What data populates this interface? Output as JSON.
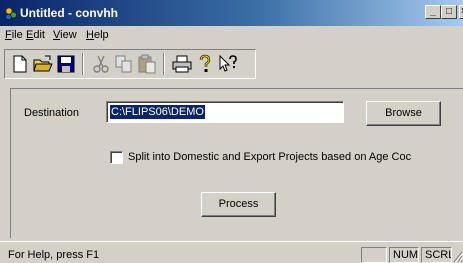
{
  "window": {
    "title": "Untitled - convhh",
    "minimize_glyph": "_",
    "maximize_glyph": "□",
    "close_glyph": "×"
  },
  "menu": {
    "items": [
      {
        "first": "F",
        "rest": "ile"
      },
      {
        "first": "E",
        "rest": "dit"
      },
      {
        "first": "V",
        "rest": "iew"
      },
      {
        "first": "H",
        "rest": "elp"
      }
    ]
  },
  "toolbar": {
    "buttons": [
      "new-file-icon",
      "open-folder-icon",
      "save-icon",
      "cut-icon",
      "copy-icon",
      "paste-icon",
      "print-icon",
      "about-icon",
      "context-help-icon"
    ]
  },
  "form": {
    "destination_label": "Destination",
    "destination_value": "C:\\FLIPS06\\DEMO",
    "browse_label": "Browse",
    "split_label": "Split into Domestic and Export Projects based on Age Coc",
    "split_checked": false,
    "process_label": "Process"
  },
  "statusbar": {
    "message": "For Help, press F1",
    "cap": "",
    "num": "NUM",
    "scrl": "SCRL"
  },
  "colors": {
    "face": "#d4d0c8",
    "title_start": "#0a246a",
    "title_end": "#a6caf0",
    "selection": "#0a246a"
  }
}
